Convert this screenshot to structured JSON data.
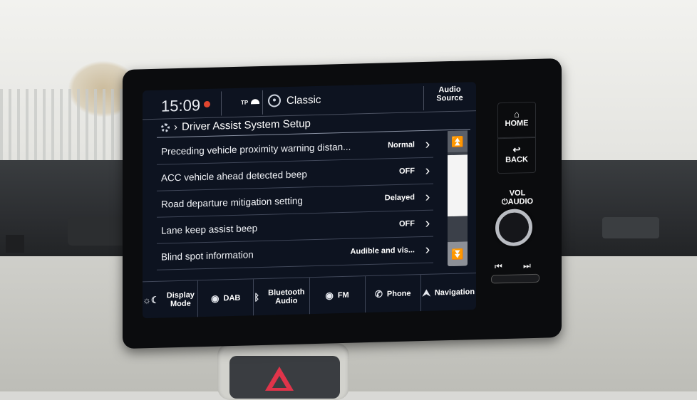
{
  "status_bar": {
    "time": "15:09",
    "tp_label": "TP",
    "station_name": "Classic",
    "audio_source_label": "Audio Source"
  },
  "breadcrumb": {
    "title": "Driver Assist System Setup"
  },
  "settings": [
    {
      "label": "Preceding vehicle proximity warning distan...",
      "value": "Normal"
    },
    {
      "label": "ACC vehicle ahead detected beep",
      "value": "OFF"
    },
    {
      "label": "Road departure mitigation setting",
      "value": "Delayed"
    },
    {
      "label": "Lane keep assist beep",
      "value": "OFF"
    },
    {
      "label": "Blind spot information",
      "value": "Audible and vis..."
    }
  ],
  "bottom_tabs": [
    {
      "label": "Display Mode",
      "icon": "display-mode-icon"
    },
    {
      "label": "DAB",
      "icon": "radio-icon"
    },
    {
      "label": "Bluetooth Audio",
      "icon": "bluetooth-icon"
    },
    {
      "label": "FM",
      "icon": "radio-icon"
    },
    {
      "label": "Phone",
      "icon": "phone-icon"
    },
    {
      "label": "Navigation",
      "icon": "navigation-icon"
    }
  ],
  "hardware": {
    "home_label": "HOME",
    "back_label": "BACK",
    "vol_label": "VOL",
    "audio_label": "AUDIO"
  },
  "scrollbar": {
    "position_fraction": 0.0
  },
  "colors": {
    "screen_bg": "#0d1320",
    "record_dot": "#e2462f",
    "hazard": "#e0344a"
  }
}
